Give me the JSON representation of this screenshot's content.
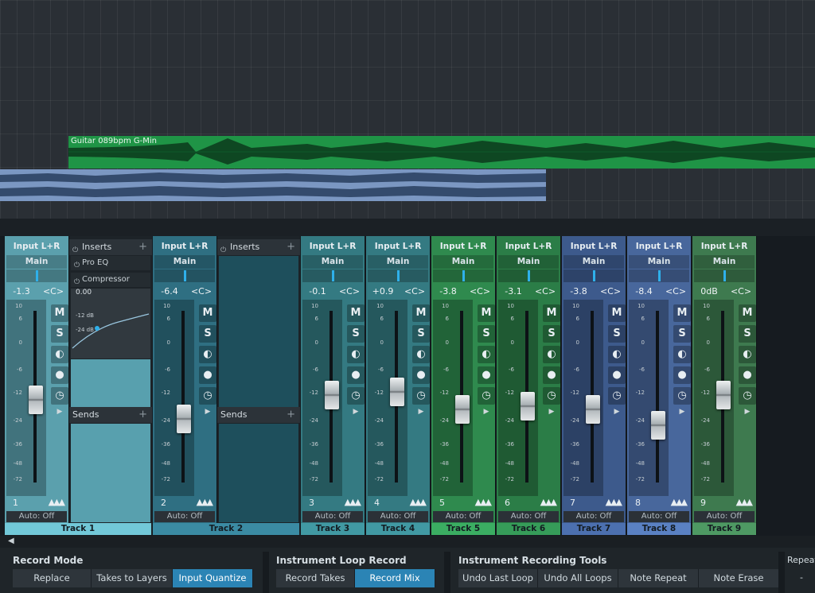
{
  "arrangement": {
    "clips": [
      {
        "label": "Guitar 089bpm G-Min",
        "color": "#1f9446"
      },
      {
        "label": "",
        "color": "#7b97c2"
      }
    ]
  },
  "mixer": {
    "scale_labels": [
      "10",
      "6",
      "0",
      "-6",
      "-12",
      "-24",
      "-36",
      "-48",
      "-72"
    ],
    "button_labels": {
      "mute": "M",
      "solo": "S"
    },
    "channels": [
      {
        "number": "1",
        "name": "Track 1",
        "input": "Input L+R",
        "output": "Main",
        "volume": "-1.3",
        "pan": "<C>",
        "auto": "Auto: Off",
        "color": "#5ba0ad",
        "fader_level": 0.53
      },
      {
        "number": "2",
        "name": "Track 2",
        "input": "Input L+R",
        "output": "Main",
        "volume": "-6.4",
        "pan": "<C>",
        "auto": "Auto: Off",
        "color": "#2f6f82",
        "fader_level": 0.41
      },
      {
        "number": "3",
        "name": "Track 3",
        "input": "Input L+R",
        "output": "Main",
        "volume": "-0.1",
        "pan": "<C>",
        "auto": "Auto: Off",
        "color": "#347a82",
        "fader_level": 0.56
      },
      {
        "number": "4",
        "name": "Track 4",
        "input": "Input L+R",
        "output": "Main",
        "volume": "+0.9",
        "pan": "<C>",
        "auto": "Auto: Off",
        "color": "#347a82",
        "fader_level": 0.58
      },
      {
        "number": "5",
        "name": "Track 5",
        "input": "Input L+R",
        "output": "Main",
        "volume": "-3.8",
        "pan": "<C>",
        "auto": "Auto: Off",
        "color": "#2f8a4e",
        "fader_level": 0.47
      },
      {
        "number": "6",
        "name": "Track 6",
        "input": "Input L+R",
        "output": "Main",
        "volume": "-3.1",
        "pan": "<C>",
        "auto": "Auto: Off",
        "color": "#2b7d47",
        "fader_level": 0.49
      },
      {
        "number": "7",
        "name": "Track 7",
        "input": "Input L+R",
        "output": "Main",
        "volume": "-3.8",
        "pan": "<C>",
        "auto": "Auto: Off",
        "color": "#3d5a8c",
        "fader_level": 0.47
      },
      {
        "number": "8",
        "name": "Track 8",
        "input": "Input L+R",
        "output": "Main",
        "volume": "-8.4",
        "pan": "<C>",
        "auto": "Auto: Off",
        "color": "#48679c",
        "fader_level": 0.37
      },
      {
        "number": "9",
        "name": "Track 9",
        "input": "Input L+R",
        "output": "Main",
        "volume": "0dB",
        "pan": "<C>",
        "auto": "Auto: Off",
        "color": "#3e7a4f",
        "fader_level": 0.56
      }
    ],
    "panel1": {
      "inserts_title": "Inserts",
      "plugins": [
        "Pro EQ",
        "Compressor"
      ],
      "eq_value": "0.00",
      "eq_labels": [
        "-12 dB",
        "-24 dB"
      ],
      "sends_title": "Sends"
    },
    "panel2": {
      "inserts_title": "Inserts",
      "sends_title": "Sends"
    }
  },
  "toolbar": {
    "record_mode": {
      "title": "Record Mode",
      "buttons": [
        "Replace",
        "Takes to Layers",
        "Input Quantize"
      ],
      "active": "Input Quantize"
    },
    "loop_record": {
      "title": "Instrument Loop Record",
      "buttons": [
        "Record Takes",
        "Record Mix"
      ],
      "active": "Record Mix"
    },
    "instrument_tools": {
      "title": "Instrument Recording Tools",
      "buttons": [
        "Undo Last Loop",
        "Undo All Loops",
        "Note Repeat",
        "Note Erase"
      ]
    },
    "repeat": {
      "label": "Repeat",
      "value": "-"
    }
  },
  "colors": {
    "accent": "#2b84b5",
    "pan_tick": "#2fb0ea"
  }
}
